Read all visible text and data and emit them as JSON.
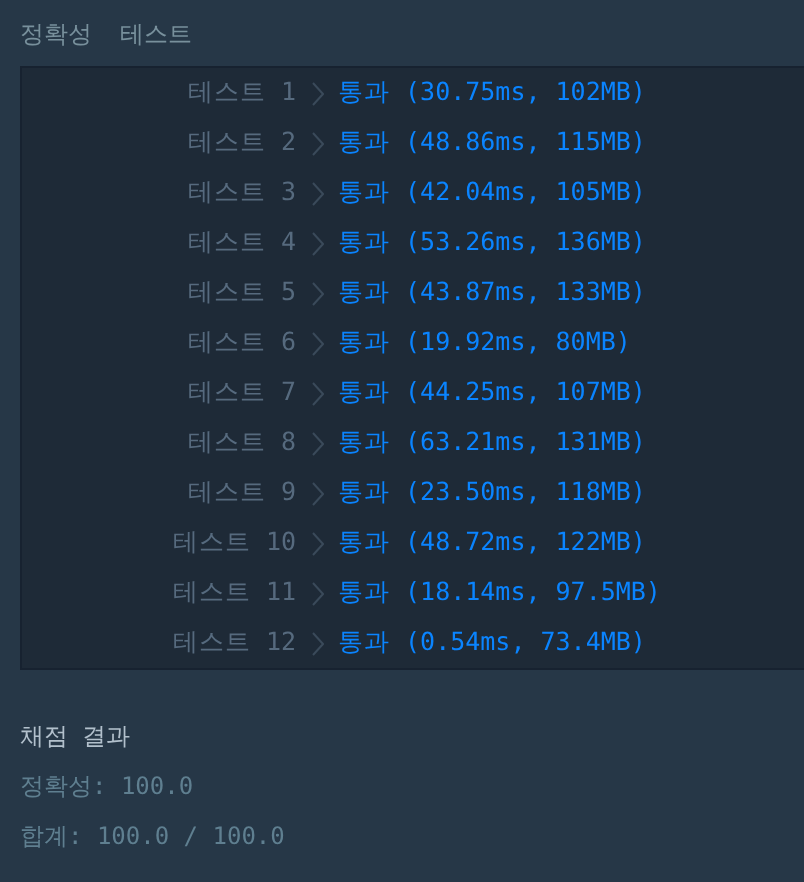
{
  "header": {
    "category": "정확성",
    "title": "테스트"
  },
  "tests": [
    {
      "label": "테스트 1",
      "status": "통과",
      "result": "(30.75ms, 102MB)"
    },
    {
      "label": "테스트 2",
      "status": "통과",
      "result": "(48.86ms, 115MB)"
    },
    {
      "label": "테스트 3",
      "status": "통과",
      "result": "(42.04ms, 105MB)"
    },
    {
      "label": "테스트 4",
      "status": "통과",
      "result": "(53.26ms, 136MB)"
    },
    {
      "label": "테스트 5",
      "status": "통과",
      "result": "(43.87ms, 133MB)"
    },
    {
      "label": "테스트 6",
      "status": "통과",
      "result": "(19.92ms, 80MB)"
    },
    {
      "label": "테스트 7",
      "status": "통과",
      "result": "(44.25ms, 107MB)"
    },
    {
      "label": "테스트 8",
      "status": "통과",
      "result": "(63.21ms, 131MB)"
    },
    {
      "label": "테스트 9",
      "status": "통과",
      "result": "(23.50ms, 118MB)"
    },
    {
      "label": "테스트 10",
      "status": "통과",
      "result": "(48.72ms, 122MB)"
    },
    {
      "label": "테스트 11",
      "status": "통과",
      "result": "(18.14ms, 97.5MB)"
    },
    {
      "label": "테스트 12",
      "status": "통과",
      "result": "(0.54ms, 73.4MB)"
    }
  ],
  "summary": {
    "title": "채점 결과",
    "accuracy": "정확성: 100.0",
    "total": "합계: 100.0 / 100.0"
  }
}
